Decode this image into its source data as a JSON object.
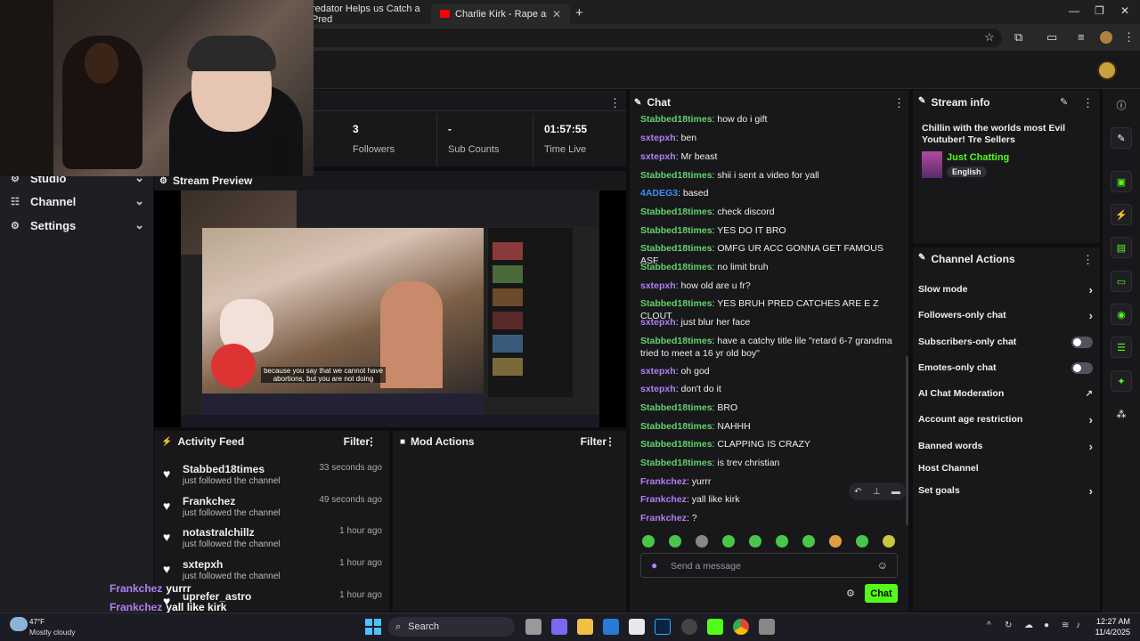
{
  "browser": {
    "tabs": [
      {
        "label": "redator Helps us Catch a Pred"
      },
      {
        "label": "Charlie Kirk - Rape and Abortic"
      }
    ]
  },
  "nav": {
    "items": [
      {
        "label": "Studio"
      },
      {
        "label": "Channel"
      },
      {
        "label": "Settings"
      }
    ]
  },
  "stats": [
    {
      "value": "3",
      "label": "Followers"
    },
    {
      "value": "-",
      "label": "Sub Counts"
    },
    {
      "value": "01:57:55",
      "label": "Time Live"
    }
  ],
  "preview": {
    "title": "Stream Preview",
    "caption": "because you say that we cannot have abortions, but you are not doing"
  },
  "activity": {
    "title": "Activity Feed",
    "filter": "Filter",
    "items": [
      {
        "name": "Stabbed18times",
        "sub": "just followed the channel",
        "time": "33 seconds ago"
      },
      {
        "name": "Frankchez",
        "sub": "just followed the channel",
        "time": "49 seconds ago"
      },
      {
        "name": "notastralchillz",
        "sub": "just followed the channel",
        "time": "1 hour ago"
      },
      {
        "name": "sxtepxh",
        "sub": "just followed the channel",
        "time": "1 hour ago"
      },
      {
        "name": "uprefer_astro",
        "sub": "",
        "time": "1 hour ago"
      }
    ]
  },
  "mod": {
    "title": "Mod Actions",
    "filter": "Filter"
  },
  "chat": {
    "title": "Chat",
    "messages": [
      {
        "user": "Stabbed18times",
        "text": "how do i gift"
      },
      {
        "user": "sxtepxh",
        "text": "ben"
      },
      {
        "user": "sxtepxh",
        "text": "Mr beast"
      },
      {
        "user": "Stabbed18times",
        "text": "shii i sent a video for yall"
      },
      {
        "user": "4ADEG3",
        "text": "based"
      },
      {
        "user": "Stabbed18times",
        "text": "check discord"
      },
      {
        "user": "Stabbed18times",
        "text": "YES DO IT BRO"
      },
      {
        "user": "Stabbed18times",
        "text": "OMFG UR ACC GONNA GET FAMOUS ASF"
      },
      {
        "user": "Stabbed18times",
        "text": "no limit bruh"
      },
      {
        "user": "sxtepxh",
        "text": "how old are u fr?"
      },
      {
        "user": "Stabbed18times",
        "text": "YES BRUH PRED CATCHES ARE E Z CLOUT"
      },
      {
        "user": "sxtepxh",
        "text": "just blur her face"
      },
      {
        "user": "Stabbed18times",
        "text": "have a catchy title lile \"retard 6-7 grandma tried to meet a 16 yr old boy\""
      },
      {
        "user": "sxtepxh",
        "text": "oh god"
      },
      {
        "user": "sxtepxh",
        "text": "don't do it"
      },
      {
        "user": "Stabbed18times",
        "text": "BRO"
      },
      {
        "user": "Stabbed18times",
        "text": "NAHHH"
      },
      {
        "user": "Stabbed18times",
        "text": "CLAPPING IS CRAZY"
      },
      {
        "user": "Stabbed18times",
        "text": "is trev christian"
      },
      {
        "user": "Frankchez",
        "text": "yurrr"
      },
      {
        "user": "Frankchez",
        "text": "yall like kirk"
      },
      {
        "user": "Frankchez",
        "text": "?"
      }
    ],
    "placeholder": "Send a message",
    "send_label": "Chat"
  },
  "stream_info": {
    "title": "Stream info",
    "stream_title": "Chillin with the worlds most Evil Youtuber! Tre Sellers",
    "category": "Just Chatting",
    "language": "English"
  },
  "channel_actions": {
    "title": "Channel Actions",
    "items": [
      {
        "label": "Slow mode",
        "control": "chevron"
      },
      {
        "label": "Followers-only chat",
        "control": "chevron"
      },
      {
        "label": "Subscribers-only chat",
        "control": "toggle"
      },
      {
        "label": "Emotes-only chat",
        "control": "toggle"
      },
      {
        "label": "AI Chat Moderation",
        "control": "external"
      },
      {
        "label": "Account age restriction",
        "control": "chevron"
      },
      {
        "label": "Banned words",
        "control": "chevron"
      },
      {
        "label": "Host Channel",
        "control": "none"
      },
      {
        "label": "Set goals",
        "control": "chevron"
      }
    ]
  },
  "overlay_chat": [
    {
      "user": "Frankchez",
      "text": "yurrr"
    },
    {
      "user": "Frankchez",
      "text": "yall like kirk"
    },
    {
      "user": "Frankchez",
      "text": "?"
    }
  ],
  "taskbar": {
    "weather_temp": "47°F",
    "weather_desc": "Mostly cloudy",
    "search": "Search",
    "time": "12:27 AM",
    "date": "11/4/2025"
  },
  "colors": {
    "accent": "#53fc18",
    "username_green": "#61d36a",
    "username_purple": "#b27ef2",
    "username_blue": "#3d8cf6"
  }
}
